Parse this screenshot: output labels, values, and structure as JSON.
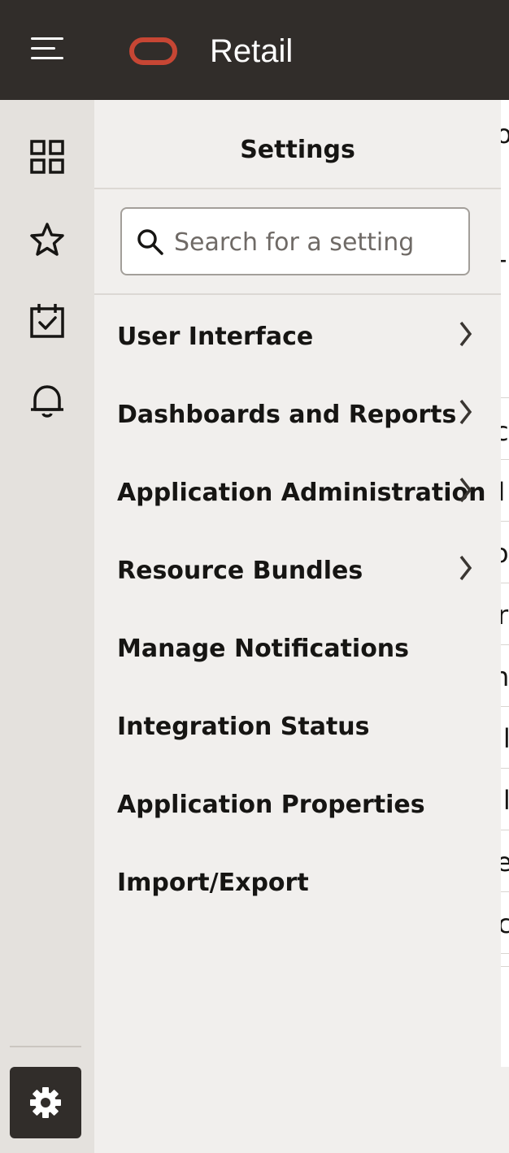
{
  "header": {
    "app_title": "Retail",
    "menu_icon": "hamburger-icon",
    "logo": "oracle-logo",
    "brand_color": "#c74634",
    "bar_color": "#312d2a"
  },
  "rail": {
    "items": [
      {
        "icon": "dashboard-grid-icon"
      },
      {
        "icon": "star-icon"
      },
      {
        "icon": "calendar-check-icon"
      },
      {
        "icon": "bell-icon"
      }
    ],
    "settings_icon": "gear-icon"
  },
  "settings_panel": {
    "title": "Settings",
    "search_placeholder": "Search for a setting",
    "items": [
      {
        "label": "User Interface",
        "has_submenu": true
      },
      {
        "label": "Dashboards and Reports",
        "has_submenu": true
      },
      {
        "label": "Application Administration",
        "has_submenu": true
      },
      {
        "label": "Resource Bundles",
        "has_submenu": true
      },
      {
        "label": "Manage Notifications",
        "has_submenu": false
      },
      {
        "label": "Integration Status",
        "has_submenu": false
      },
      {
        "label": "Application Properties",
        "has_submenu": false
      },
      {
        "label": "Import/Export",
        "has_submenu": false
      }
    ]
  },
  "background_page": {
    "partial_glyphs": [
      "ol",
      "-",
      "c",
      "I",
      "o",
      "r",
      "n",
      "il",
      "il",
      "e",
      "ca"
    ]
  }
}
